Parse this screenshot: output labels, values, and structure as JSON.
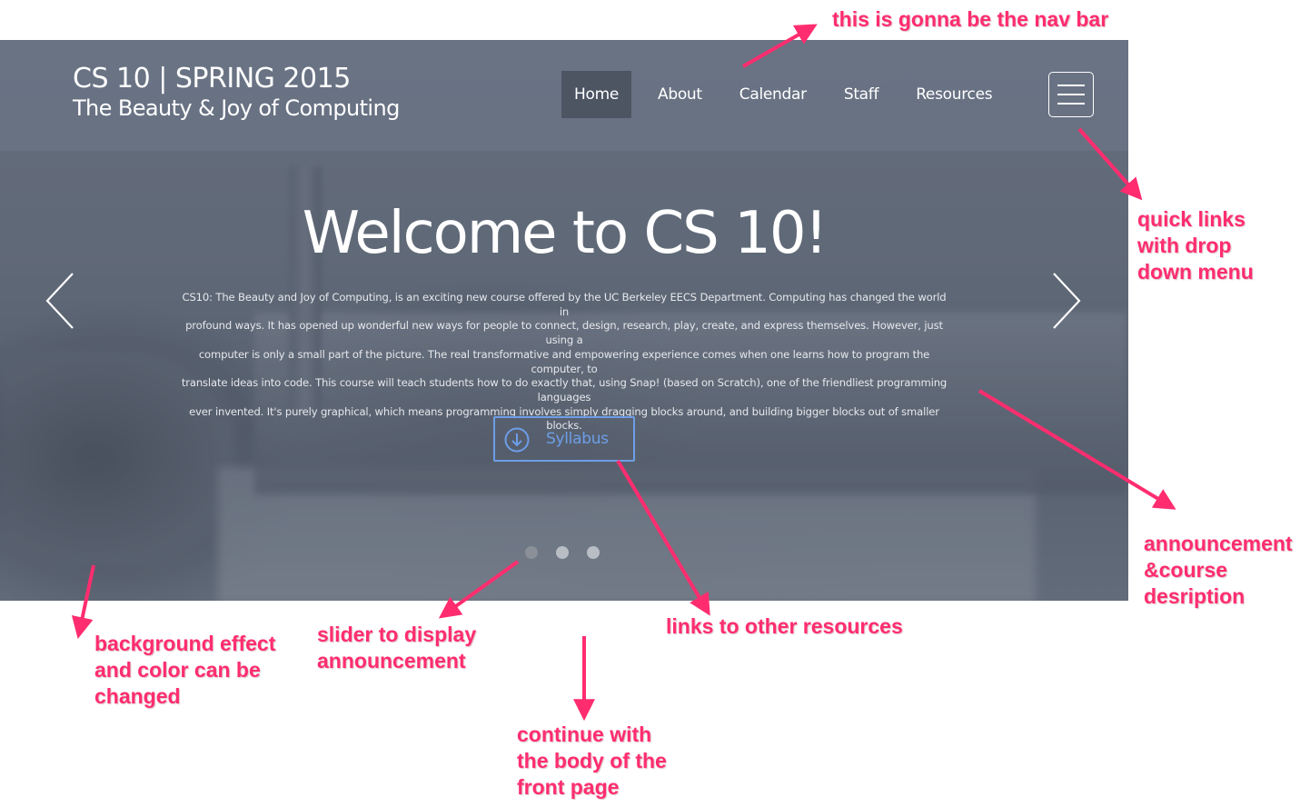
{
  "nav": {
    "brand_title": "CS 10 | SPRING 2015",
    "brand_subtitle": "The Beauty & Joy of Computing",
    "items": [
      {
        "label": "Home",
        "active": true
      },
      {
        "label": "About",
        "active": false
      },
      {
        "label": "Calendar",
        "active": false
      },
      {
        "label": "Staff",
        "active": false
      },
      {
        "label": "Resources",
        "active": false
      }
    ],
    "menu_icon": "hamburger-icon"
  },
  "hero": {
    "title": "Welcome to CS 10!",
    "description_lines": [
      "CS10: The Beauty and Joy of Computing, is an exciting new course offered by the UC Berkeley EECS Department. Computing has changed the world in",
      "profound ways. It has opened up wonderful new ways for people to connect, design, research, play, create, and express themselves. However, just using a",
      "computer is only a small part of the picture. The real transformative and empowering experience comes when one learns how to program the computer, to",
      "translate ideas into code. This course will teach students how to do exactly that, using Snap! (based on Scratch), one of the friendliest programming languages",
      "ever invented. It's purely graphical, which means programming involves simply dragging blocks around, and building bigger blocks out of smaller blocks."
    ],
    "button_label": "Syllabus",
    "button_icon": "download-circle-icon",
    "prev_icon": "chevron-left-icon",
    "next_icon": "chevron-right-icon",
    "slides_count": 3,
    "active_slide": 1
  },
  "annotations": {
    "nav_bar": "this is gonna be the nav bar",
    "quick_links": [
      "quick links",
      "with drop",
      "down menu"
    ],
    "announcement": [
      "announcement",
      "&course",
      "desription"
    ],
    "background": [
      "background effect",
      "and color can be",
      "changed"
    ],
    "slider": [
      "slider to display",
      "announcement"
    ],
    "links": "links to other resources",
    "continue": [
      "continue with",
      "the body of the",
      "front page"
    ]
  },
  "colors": {
    "annotation": "#ff2d6f",
    "button_accent": "#6d9ee8",
    "nav_active_bg": "#4d5563"
  }
}
